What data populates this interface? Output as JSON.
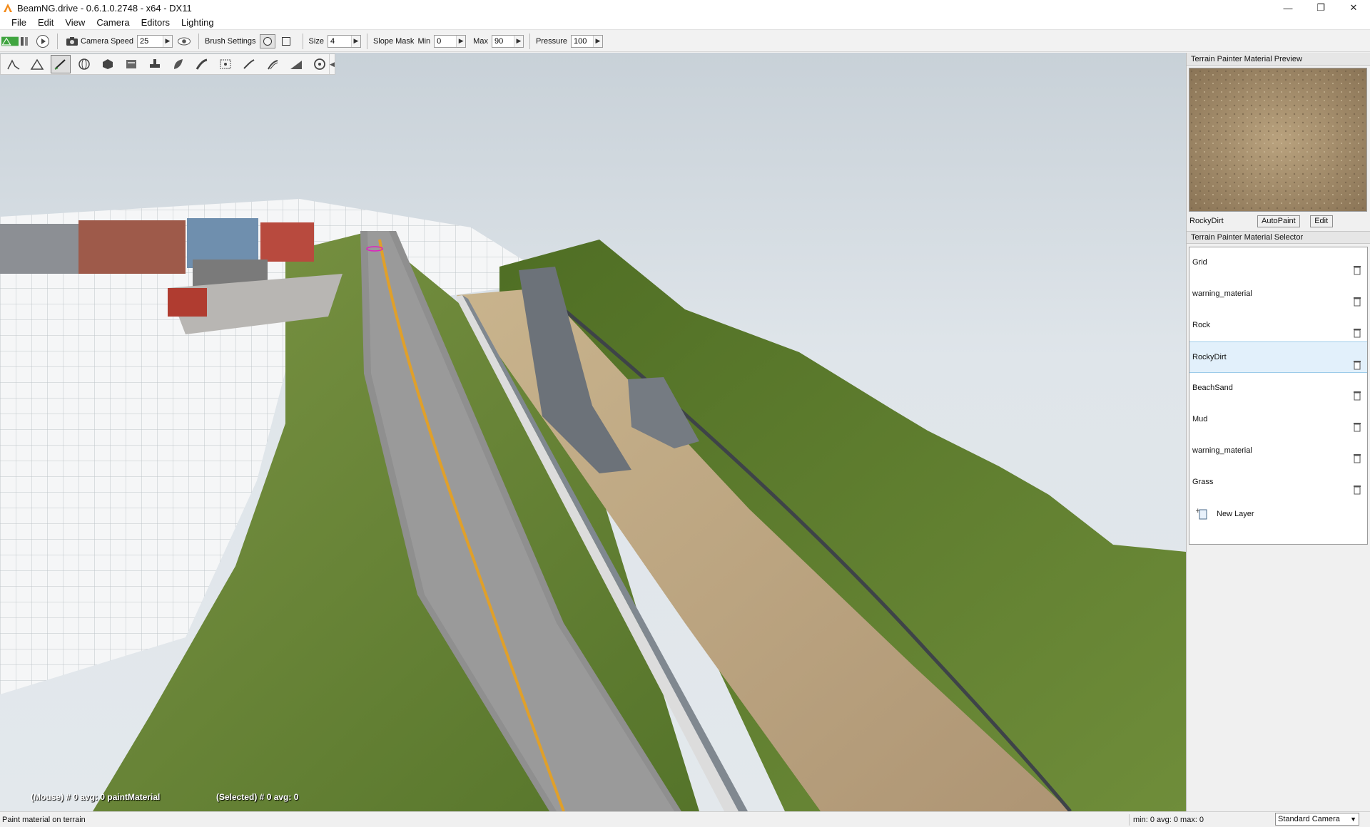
{
  "window": {
    "title": "BeamNG.drive - 0.6.1.0.2748 - x64 - DX11",
    "minimize": "—",
    "restore": "❐",
    "close": "✕"
  },
  "menu": [
    "File",
    "Edit",
    "View",
    "Camera",
    "Editors",
    "Lighting"
  ],
  "toolbar": {
    "camera_speed_label": "Camera Speed",
    "camera_speed_value": "25",
    "brush_settings_label": "Brush Settings",
    "size_label": "Size",
    "size_value": "4",
    "slope_mask_label": "Slope Mask",
    "min_label": "Min",
    "min_value": "0",
    "max_label": "Max",
    "max_value": "90",
    "pressure_label": "Pressure",
    "pressure_value": "100"
  },
  "hud": {
    "mouse": "(Mouse) # 0  avg: 0 paintMaterial",
    "selected": "(Selected) # 0  avg: 0"
  },
  "preview_panel": {
    "header": "Terrain Painter Material Preview",
    "material_name": "RockyDirt",
    "autopaint_label": "AutoPaint",
    "edit_label": "Edit"
  },
  "selector_panel": {
    "header": "Terrain Painter Material Selector",
    "materials": [
      "Grid",
      "warning_material",
      "Rock",
      "RockyDirt",
      "BeachSand",
      "Mud",
      "warning_material",
      "Grass"
    ],
    "selected_index": 3,
    "new_layer_label": "New Layer"
  },
  "status": {
    "message": "Paint material on terrain",
    "stats": "min: 0  avg: 0  max: 0",
    "camera": "Standard Camera"
  },
  "colors": {
    "sky": "#dde3e8",
    "grass": "#5f7e2e",
    "dirt": "#b8a17c",
    "road": "#8e8e8e",
    "road_line": "#e0a02a",
    "selection": "#e2f0fb"
  }
}
